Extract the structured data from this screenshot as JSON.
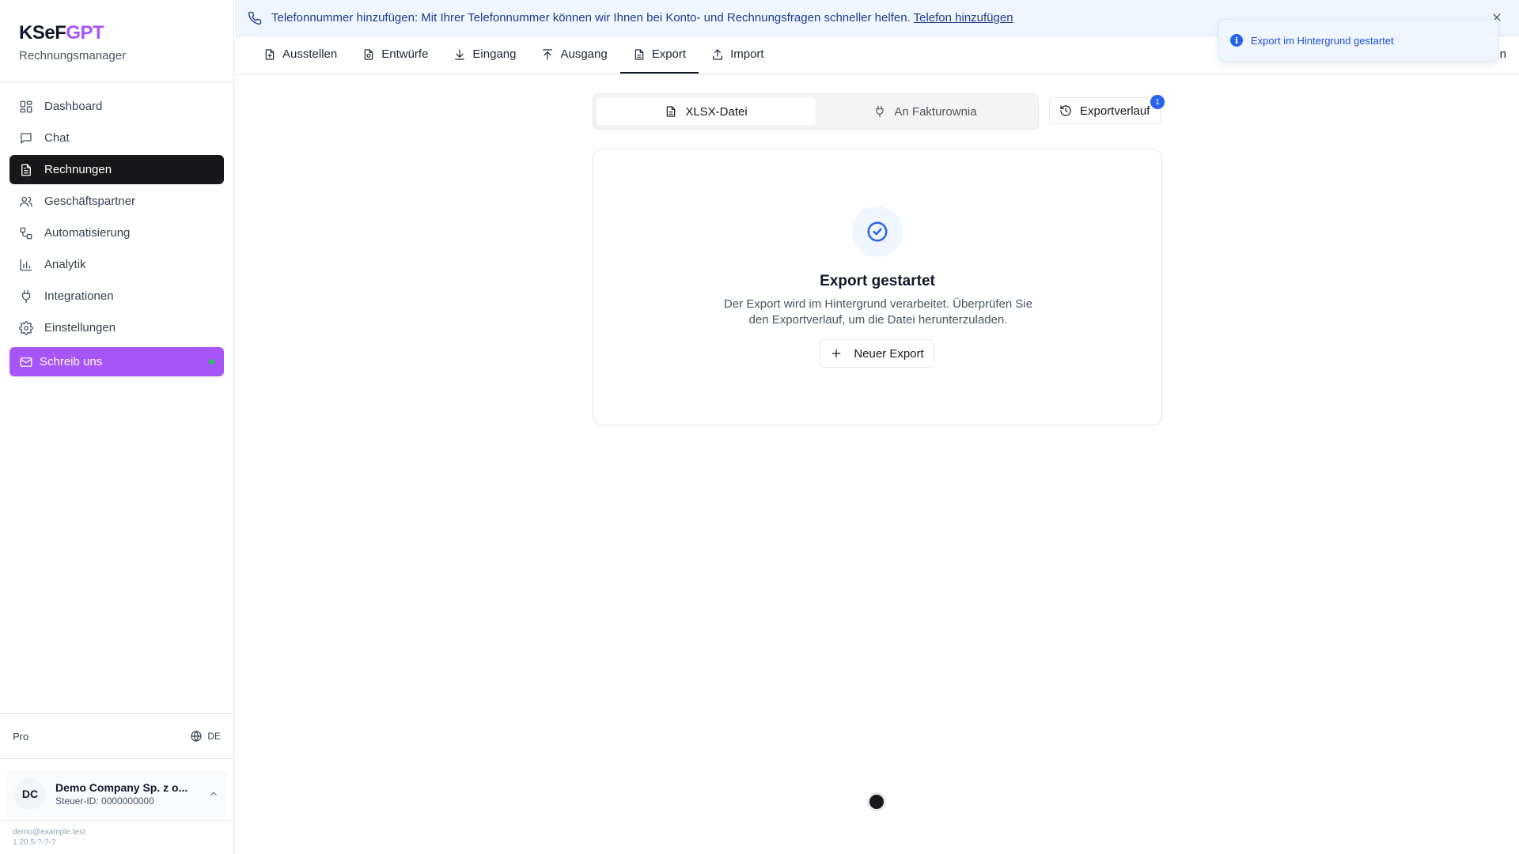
{
  "brand": {
    "logo_main": "KSeF",
    "logo_accent": "GPT",
    "subtitle": "Rechnungsmanager"
  },
  "sidebar": {
    "items": [
      {
        "label": "Dashboard",
        "icon": "dashboard-icon"
      },
      {
        "label": "Chat",
        "icon": "chat-icon"
      },
      {
        "label": "Rechnungen",
        "icon": "document-icon",
        "active": true
      },
      {
        "label": "Geschäftspartner",
        "icon": "users-icon"
      },
      {
        "label": "Automatisierung",
        "icon": "workflow-icon"
      },
      {
        "label": "Analytik",
        "icon": "bar-chart-icon"
      },
      {
        "label": "Integrationen",
        "icon": "plug-icon"
      },
      {
        "label": "Einstellungen",
        "icon": "gear-icon"
      }
    ],
    "cta": {
      "label": "Schreib uns",
      "icon": "mail-icon",
      "status_color": "#22c55e"
    },
    "plan": "Pro",
    "language": "DE",
    "company": {
      "initials": "DC",
      "name": "Demo Company Sp. z o...",
      "tax_id": "Steuer-ID: 0000000000"
    },
    "user_email": "demo@example.test",
    "version": "1.20.5-?-?-?"
  },
  "banner": {
    "text": "Telefonnummer hinzufügen: Mit Ihrer Telefonnummer können wir Ihnen bei Konto- und Rechnungsfragen schneller helfen.",
    "link": "Telefon hinzufügen"
  },
  "tabs": [
    {
      "label": "Ausstellen",
      "icon": "file-plus-icon"
    },
    {
      "label": "Entwürfe",
      "icon": "file-edit-icon"
    },
    {
      "label": "Eingang",
      "icon": "download-icon"
    },
    {
      "label": "Ausgang",
      "icon": "upload-icon"
    },
    {
      "label": "Export",
      "icon": "file-text-icon",
      "active": true
    },
    {
      "label": "Import",
      "icon": "import-icon"
    }
  ],
  "tabs_tail": "n",
  "export": {
    "format_options": [
      {
        "label": "XLSX-Datei",
        "icon": "file-icon",
        "active": true
      },
      {
        "label": "An Fakturownia",
        "icon": "plug-icon"
      }
    ],
    "history_button": "Exportverlauf",
    "history_badge": "1",
    "status_title": "Export gestartet",
    "status_description": "Der Export wird im Hintergrund verarbeitet. Überprüfen Sie den Exportverlauf, um die Datei herunterzuladen.",
    "new_export_button": "Neuer Export"
  },
  "toast": {
    "message": "Export im Hintergrund gestartet"
  },
  "colors": {
    "accent": "#a855f7",
    "active_nav": "#18181b",
    "info": "#2563eb",
    "banner_bg": "#eff6ff"
  }
}
